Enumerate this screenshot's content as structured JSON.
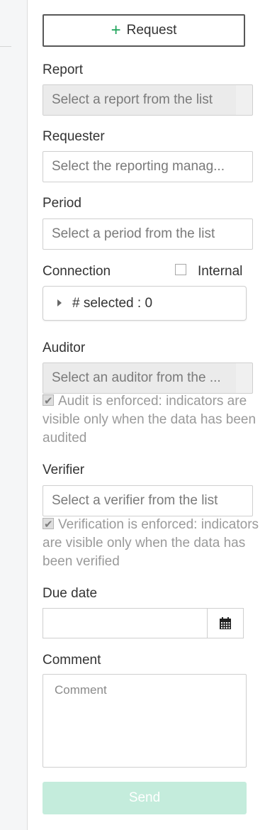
{
  "request_button": {
    "plus": "+",
    "label": "Request"
  },
  "report": {
    "label": "Report",
    "placeholder": "Select a report from the list"
  },
  "requester": {
    "label": "Requester",
    "placeholder": "Select the reporting manag..."
  },
  "period": {
    "label": "Period",
    "placeholder": "Select a period from the list"
  },
  "connection": {
    "label": "Connection",
    "internal_label": "Internal",
    "internal_checked": false,
    "selected_text": "# selected : 0"
  },
  "auditor": {
    "label": "Auditor",
    "placeholder": "Select an auditor from the ...",
    "note": "Audit is enforced: indicators are visible only when the data has been audited"
  },
  "verifier": {
    "label": "Verifier",
    "placeholder": "Select a verifier from the list",
    "note": "Verification is enforced: indicators are visible only when the data has been verified"
  },
  "due_date": {
    "label": "Due date",
    "value": ""
  },
  "comment": {
    "label": "Comment",
    "placeholder": "Comment"
  },
  "send_button": {
    "label": "Send"
  },
  "colors": {
    "accent_green": "#1fa45b",
    "send_disabled": "#c4ecdc"
  }
}
